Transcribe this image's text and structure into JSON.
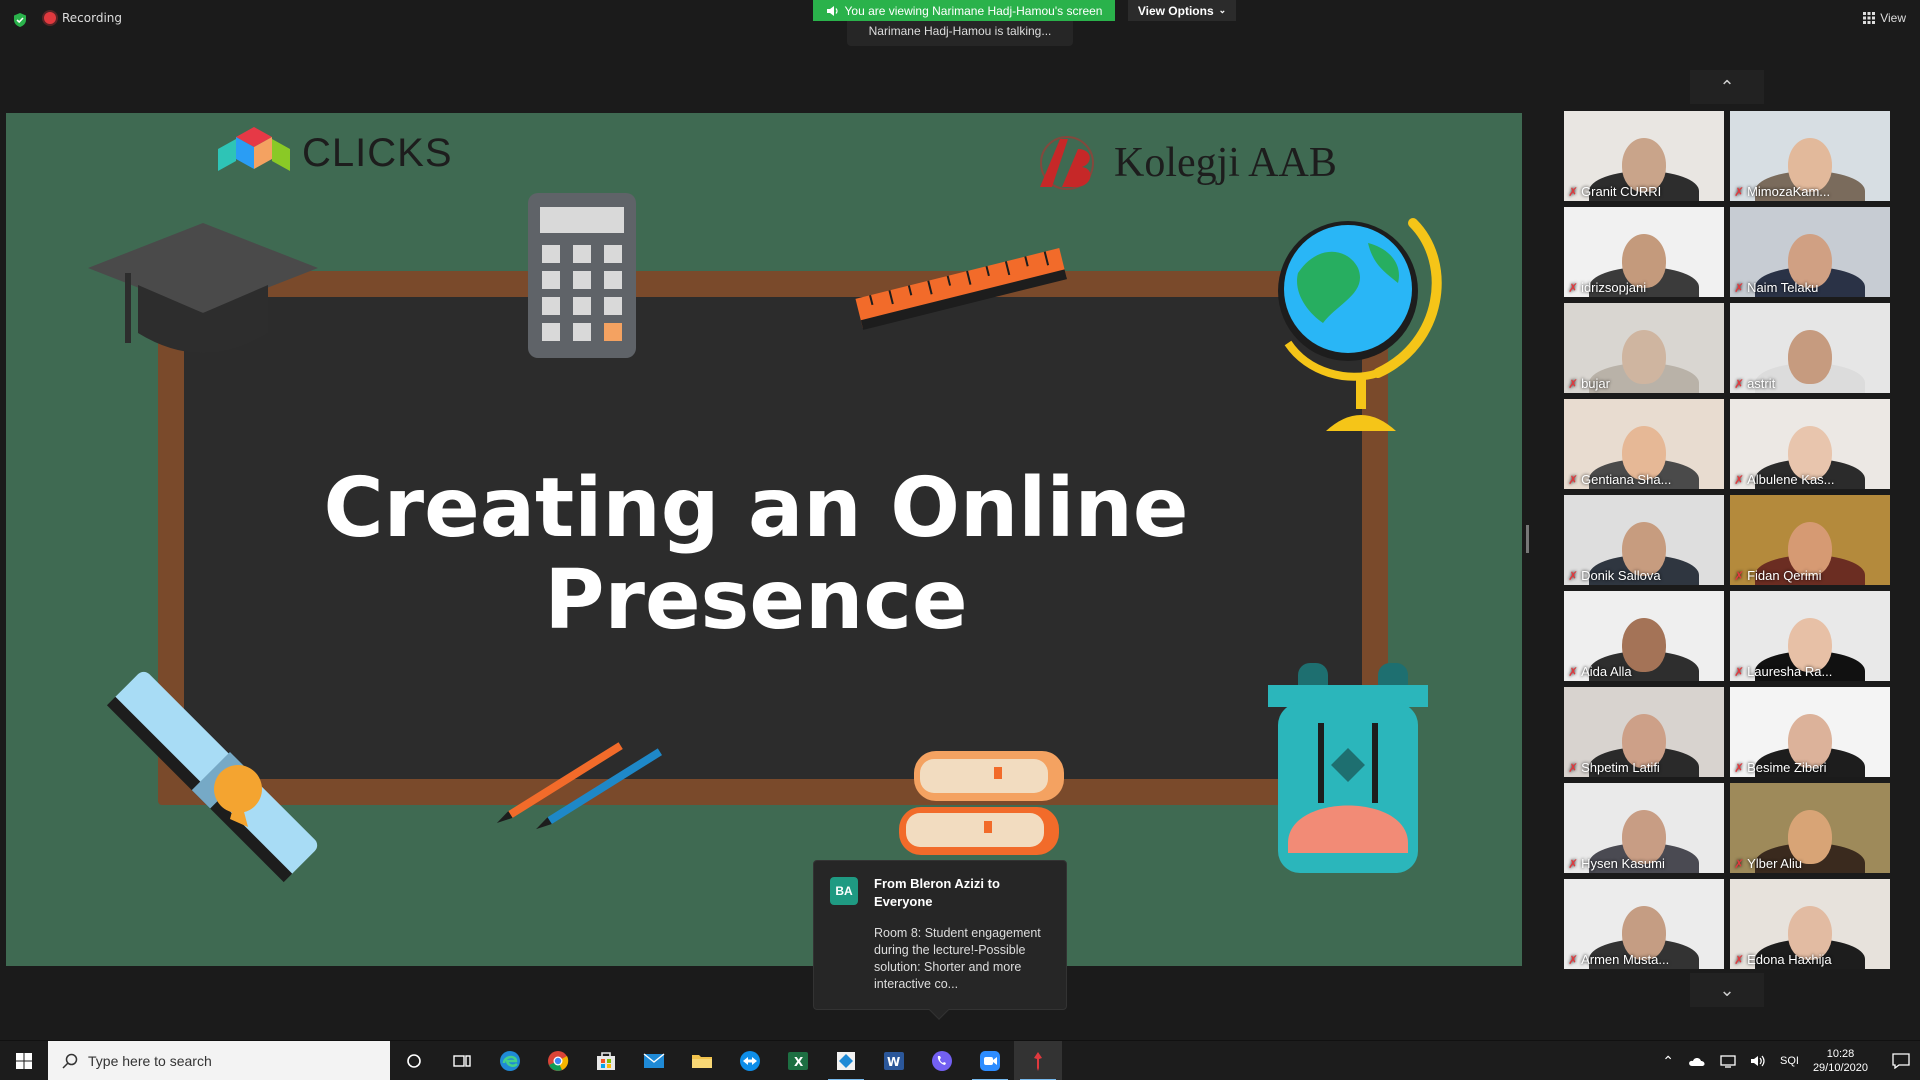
{
  "topbar": {
    "recording_label": "Recording",
    "viewing_label": "You are viewing Narimane Hadj-Hamou's screen",
    "talking_label": "Narimane Hadj-Hamou is talking...",
    "view_options_label": "View Options",
    "view_label": "View"
  },
  "slide": {
    "title_line1": "Creating an Online",
    "title_line2": "Presence",
    "logo_left": "CLICKS",
    "logo_right": "Kolegji AAB"
  },
  "participants": [
    {
      "name": "Granit CURRI",
      "skin": "#c9a48a",
      "shirt": "#2d2d2d",
      "bg": "#e9e6e2"
    },
    {
      "name": "MimozaKam...",
      "skin": "#e2b99b",
      "shirt": "#7a6b5c",
      "bg": "#d7dee3"
    },
    {
      "name": "idrizsopjani",
      "skin": "#c49a7c",
      "shirt": "#3b3b3b",
      "bg": "#f1f1f1"
    },
    {
      "name": "Naim Telaku",
      "skin": "#d0a083",
      "shirt": "#2a3246",
      "bg": "#c7ccd3"
    },
    {
      "name": "bujar",
      "skin": "#cfb5a0",
      "shirt": "#b9b2a8",
      "bg": "#d9d6d1"
    },
    {
      "name": "astrit",
      "skin": "#c69b7f",
      "shirt": "#dcdcdc",
      "bg": "#e6e6e6"
    },
    {
      "name": "Gentiana Sha...",
      "skin": "#e6b896",
      "shirt": "#4a4a4a",
      "bg": "#e8dcd0"
    },
    {
      "name": "Albulene Kas...",
      "skin": "#e8c5ad",
      "shirt": "#2b2b2b",
      "bg": "#ece8e4"
    },
    {
      "name": "Donik Sallova",
      "skin": "#c79c7f",
      "shirt": "#2f3640",
      "bg": "#dedede"
    },
    {
      "name": "Fidan Qerimi",
      "skin": "#d69a73",
      "shirt": "#6b2d22",
      "bg": "#b48a3c"
    },
    {
      "name": "Aida Alla",
      "skin": "#a47357",
      "shirt": "#2e2e2e",
      "bg": "#efefef"
    },
    {
      "name": "Lauresha Ra...",
      "skin": "#e7c0a6",
      "shirt": "#111111",
      "bg": "#e9e9e9"
    },
    {
      "name": "Shpetim Latifi",
      "skin": "#cda088",
      "shirt": "#2a2a2a",
      "bg": "#d8d3cf"
    },
    {
      "name": "Besime Ziberi",
      "skin": "#dcb29a",
      "shirt": "#1d1d1d",
      "bg": "#f4f4f4"
    },
    {
      "name": "Hysen Kasumi",
      "skin": "#c89d84",
      "shirt": "#4a4a52",
      "bg": "#eaeaea"
    },
    {
      "name": "Ylber Aliu",
      "skin": "#d8a476",
      "shirt": "#3a2a1e",
      "bg": "#9e8a5a"
    },
    {
      "name": "Armen Musta...",
      "skin": "#c59d83",
      "shirt": "#333333",
      "bg": "#ececec"
    },
    {
      "name": "Edona Haxhija",
      "skin": "#e2bba2",
      "shirt": "#1d1d1d",
      "bg": "#e7e2dc"
    }
  ],
  "chat": {
    "avatar_initials": "BA",
    "from": "From Bleron Azizi to Everyone",
    "message": "Room 8: Student engagement during the lecture!-Possible solution: Shorter and more interactive co..."
  },
  "taskbar": {
    "search_placeholder": "Type here to search",
    "language": "SQI",
    "time": "10:28",
    "date": "29/10/2020"
  },
  "colors": {
    "zoom_green": "#2ab24b",
    "slide_green": "#3f6a52",
    "muted_red": "#e0393e"
  }
}
